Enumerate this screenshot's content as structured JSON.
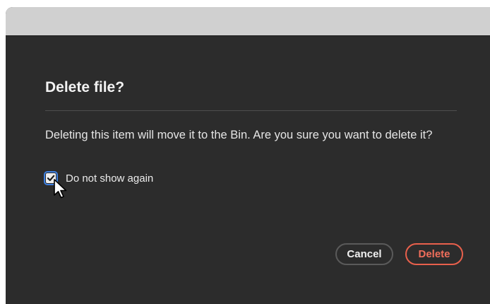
{
  "dialog": {
    "title": "Delete file?",
    "message": "Deleting this item will move it to the Bin. Are you sure you want to delete it?",
    "checkbox": {
      "label": "Do not show again",
      "checked": true
    },
    "buttons": {
      "cancel": "Cancel",
      "delete": "Delete"
    }
  },
  "colors": {
    "background": "#2c2c2c",
    "titlebar": "#d0d0d0",
    "focus_ring": "#3d7fe0",
    "destructive": "#e8604c"
  },
  "icons": {
    "checkbox_mark": "checkmark-icon",
    "cursor": "mouse-pointer-icon"
  }
}
